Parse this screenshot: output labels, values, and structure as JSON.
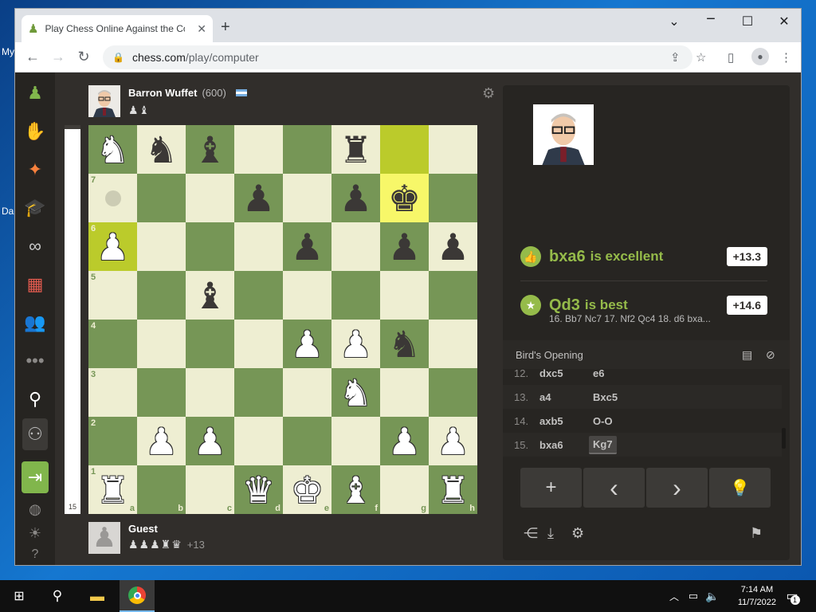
{
  "desktop": {
    "label1": "My",
    "label2": "Da"
  },
  "browser": {
    "tab_title": "Play Chess Online Against the Co",
    "url_host": "chess.com",
    "url_path": "/play/computer"
  },
  "icons": {
    "tab_favicon": "pawn-icon",
    "tab_close": "close-icon",
    "new_tab": "plus-icon",
    "back": "back-arrow-icon",
    "forward": "forward-arrow-icon",
    "reload": "reload-icon",
    "lock": "lock-icon",
    "share": "share-icon",
    "bookmark": "star-icon",
    "sidepanel": "side-panel-icon",
    "profile": "profile-icon",
    "menu": "kebab-menu-icon"
  },
  "opponent": {
    "name": "Barron Wuffet",
    "rating": "(600)",
    "captured": "♟♝"
  },
  "player": {
    "name": "Guest",
    "captured": "♟♟♟♜♛",
    "advantage": "+13"
  },
  "eval_bar": {
    "label": "15",
    "white_fraction": 0.99
  },
  "board": {
    "highlight_squares": [
      "a6",
      "g8",
      "g7"
    ],
    "hint_square": "a7",
    "pieces": {
      "a8": "wN",
      "b8": "bN",
      "c8": "bB",
      "f8": "bR",
      "d7": "bP",
      "f7": "bP",
      "g7": "bK",
      "a6": "wP",
      "e6": "bP",
      "g6": "bP",
      "h6": "bP",
      "c5": "bB",
      "e4": "wP",
      "f4": "wP",
      "g4": "bN",
      "f3": "wN",
      "b2": "wP",
      "c2": "wP",
      "g2": "wP",
      "h2": "wP",
      "a1": "wR",
      "d1": "wQ",
      "e1": "wK",
      "f1": "wB",
      "h1": "wR"
    },
    "rank_labels": [
      "7",
      "6",
      "5",
      "4",
      "3",
      "2",
      "1"
    ],
    "file_labels": [
      "a",
      "b",
      "c",
      "d",
      "e",
      "f",
      "g",
      "h"
    ]
  },
  "feedback": [
    {
      "move": "bxa6",
      "text": "is excellent",
      "eval": "+13.3",
      "icon": "thumbs-up-icon"
    },
    {
      "move": "Qd3",
      "text": "is best",
      "eval": "+14.6",
      "icon": "star-icon",
      "line": "16. Bb7 Nc7 17. Nf2 Qc4 18. d6 bxa..."
    }
  ],
  "opening": "Bird's Opening",
  "moves": [
    {
      "num": "12.",
      "white": "dxc5",
      "black": "e6"
    },
    {
      "num": "13.",
      "white": "a4",
      "black": "Bxc5"
    },
    {
      "num": "14.",
      "white": "axb5",
      "black": "O-O"
    },
    {
      "num": "15.",
      "white": "bxa6",
      "black": "Kg7"
    }
  ],
  "controls": [
    "+",
    "‹",
    "›",
    "💡"
  ],
  "taskbar": {
    "time": "7:14 AM",
    "date": "11/7/2022",
    "notifications": "1"
  },
  "colors": {
    "light_square": "#eeeed2",
    "dark_square": "#769656",
    "accent_green": "#95bb4a"
  }
}
